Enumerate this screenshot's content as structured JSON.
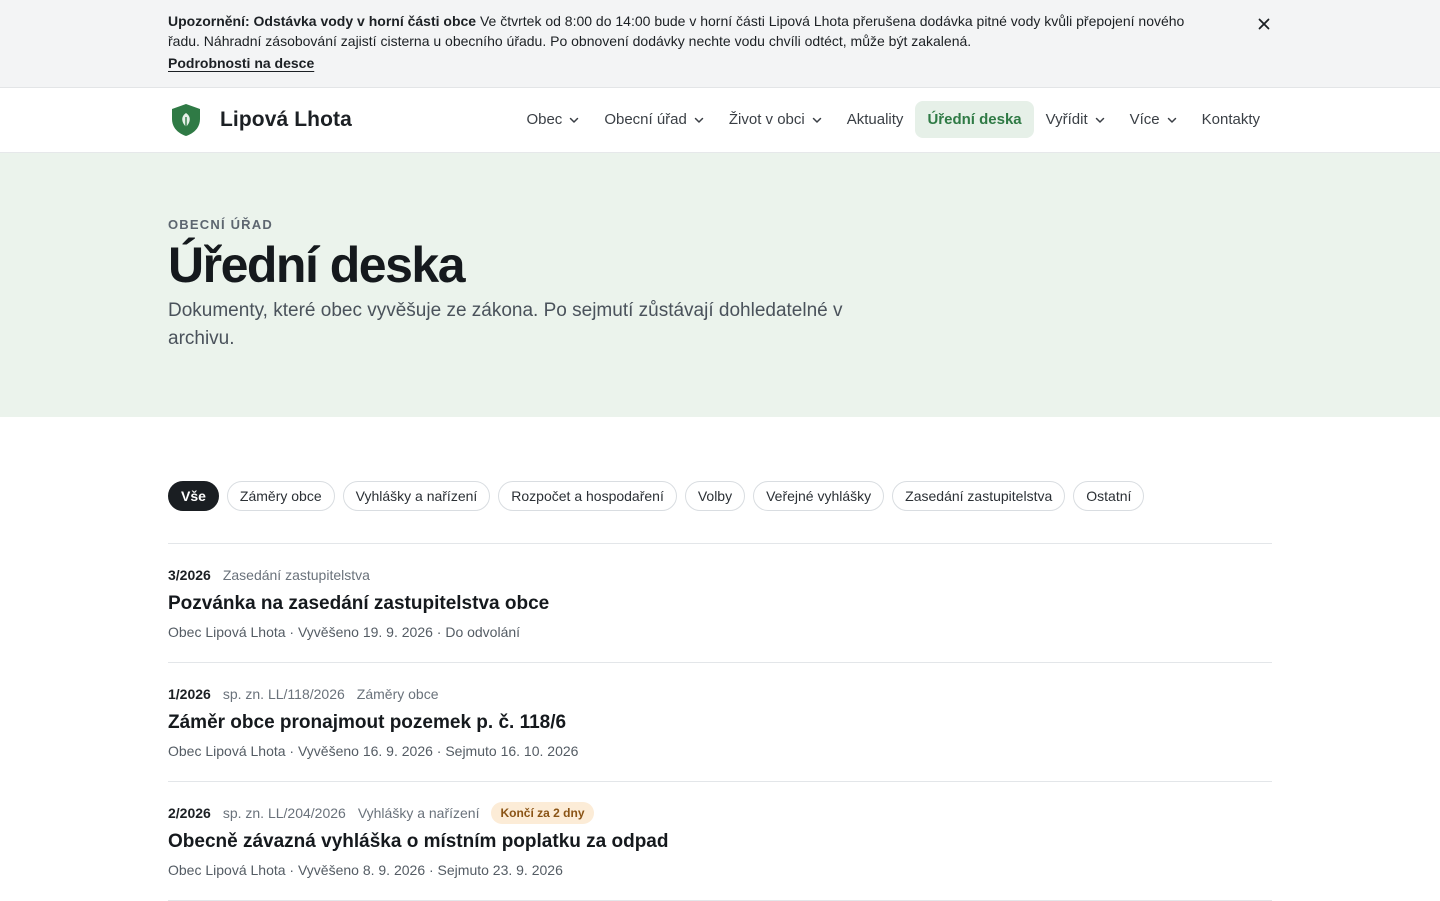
{
  "alert": {
    "title": "Upozornění: Odstávka vody v horní části obce",
    "text": "Ve čtvrtek od 8:00 do 14:00 bude v horní části Lipová Lhota přerušena dodávka pitné vody kvůli přepojení nového řadu. Náhradní zásobování zajistí cisterna u obecního úřadu. Po obnovení dodávky nechte vodu chvíli odtéct, může být zakalená.",
    "link": "Podrobnosti na desce",
    "close_icon": "close-icon"
  },
  "header": {
    "brand": "Lipová Lhota",
    "logo_icon": "shield-leaf-icon",
    "nav": [
      {
        "label": "Obec",
        "dropdown": true
      },
      {
        "label": "Obecní úřad",
        "dropdown": true
      },
      {
        "label": "Život v obci",
        "dropdown": true
      },
      {
        "label": "Aktuality",
        "dropdown": false
      },
      {
        "label": "Úřední deska",
        "dropdown": false,
        "active": true
      },
      {
        "label": "Vyřídit",
        "dropdown": true
      },
      {
        "label": "Více",
        "dropdown": true
      },
      {
        "label": "Kontakty",
        "dropdown": false
      }
    ]
  },
  "hero": {
    "eyebrow": "Obecní úřad",
    "title": "Úřední deska",
    "description": "Dokumenty, které obec vyvěšuje ze zákona. Po sejmutí zůstávají dohledatelné v archivu."
  },
  "filters": [
    {
      "label": "Vše",
      "active": true
    },
    {
      "label": "Záměry obce"
    },
    {
      "label": "Vyhlášky a nařízení"
    },
    {
      "label": "Rozpočet a hospodaření"
    },
    {
      "label": "Volby"
    },
    {
      "label": "Veřejné vyhlášky"
    },
    {
      "label": "Zasedání zastupitelstva"
    },
    {
      "label": "Ostatní"
    }
  ],
  "documents": [
    {
      "number": "3/2026",
      "ref": "",
      "category": "Zasedání zastupitelstva",
      "badge": "",
      "title": "Pozvánka na zasedání zastupitelstva obce",
      "info": "Obec Lipová Lhota · Vyvěšeno 19. 9. 2026 · Do odvolání"
    },
    {
      "number": "1/2026",
      "ref": "sp. zn. LL/118/2026",
      "category": "Záměry obce",
      "badge": "",
      "title": "Záměr obce pronajmout pozemek p. č. 118/6",
      "info": "Obec Lipová Lhota · Vyvěšeno 16. 9. 2026 · Sejmuto 16. 10. 2026"
    },
    {
      "number": "2/2026",
      "ref": "sp. zn. LL/204/2026",
      "category": "Vyhlášky a nařízení",
      "badge": "Končí za 2 dny",
      "title": "Obecně závazná vyhláška o místním poplatku za odpad",
      "info": "Obec Lipová Lhota · Vyvěšeno 8. 9. 2026 · Sejmuto 23. 9. 2026"
    }
  ],
  "colors": {
    "accent": "#2f7a45",
    "hero_bg": "#ebf3ec",
    "badge_bg": "#fcecd7",
    "badge_text": "#8a5416"
  }
}
